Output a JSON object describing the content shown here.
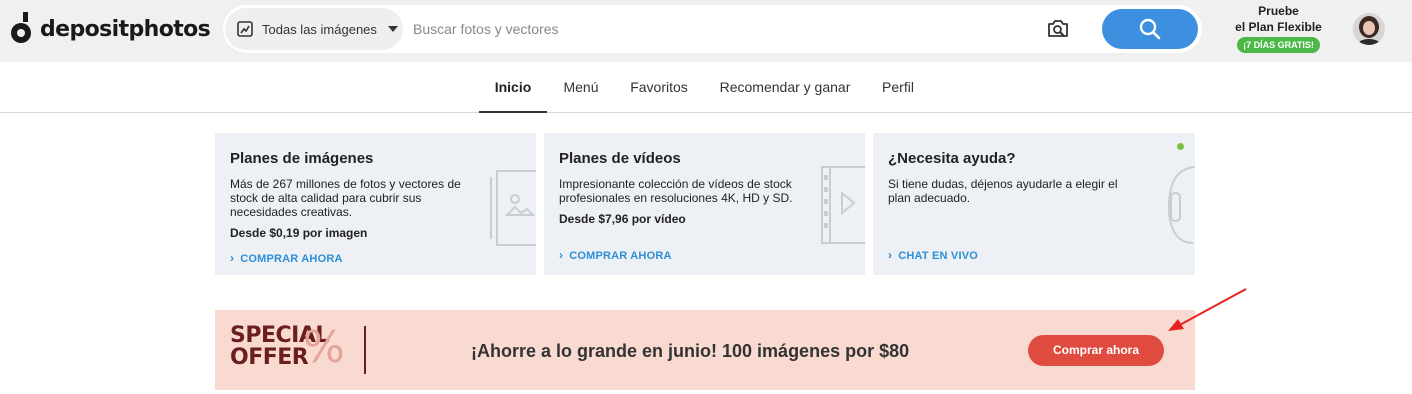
{
  "header": {
    "logo_text": "depositphotos",
    "search": {
      "type_selected": "Todas las imágenes",
      "placeholder": "Buscar fotos y vectores",
      "type_icon": "image-type-icon",
      "camera_icon": "camera-search-icon",
      "search_icon": "magnifier-icon"
    },
    "promo": {
      "line1": "Pruebe",
      "line2": "el Plan Flexible",
      "badge": "¡7 DÍAS GRATIS!"
    }
  },
  "nav": {
    "items": [
      {
        "label": "Inicio",
        "active": true
      },
      {
        "label": "Menú",
        "active": false
      },
      {
        "label": "Favoritos",
        "active": false
      },
      {
        "label": "Recomendar y ganar",
        "active": false
      },
      {
        "label": "Perfil",
        "active": false
      }
    ]
  },
  "cards": [
    {
      "title": "Planes de imágenes",
      "description": "Más de 267 millones de fotos y vectores de stock de alta calidad para cubrir sus necesidades creativas.",
      "price": "Desde $0,19 por imagen",
      "link": "COMPRAR AHORA",
      "icon": "image-frame-icon"
    },
    {
      "title": "Planes de vídeos",
      "description": "Impresionante colección de vídeos de stock profesionales en resoluciones 4K, HD y SD.",
      "price": "Desde $7,96 por vídeo",
      "link": "COMPRAR AHORA",
      "icon": "film-strip-icon"
    },
    {
      "title": "¿Necesita ayuda?",
      "description": "Si tiene dudas, déjenos ayudarle a elegir el plan adecuado.",
      "link": "CHAT EN VIVO",
      "icon": "headset-icon",
      "status_color": "#7cc242"
    }
  ],
  "banner": {
    "special_line1": "SPECIAL",
    "special_line2": "OFFER",
    "percent": "%",
    "text": "¡Ahorre a lo grande en junio! 100 imágenes por $80",
    "button": "Comprar ahora"
  },
  "colors": {
    "accent_blue": "#3d8fe0",
    "link_blue": "#2d8fd5",
    "badge_green": "#4cb848",
    "banner_bg": "#f9dad1",
    "cta_red": "#e04b3f"
  }
}
